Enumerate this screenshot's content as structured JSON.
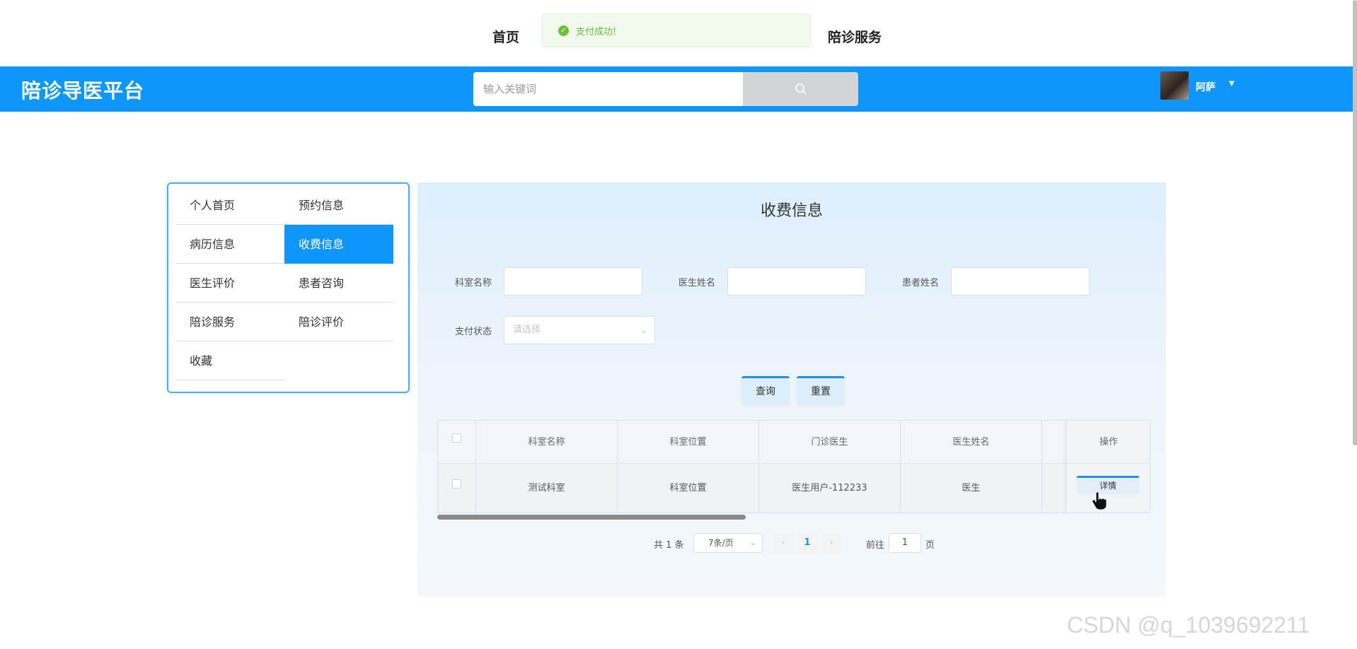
{
  "nav": {
    "home": "首页",
    "escort_service": "陪诊服务"
  },
  "toast": {
    "message": "支付成功!",
    "icon": "check-circle-icon",
    "color": "#67c23a"
  },
  "header": {
    "logo": "陪诊导医平台",
    "search_placeholder": "输入关键词",
    "username": "阿萨",
    "brand_color": "#0e96fa"
  },
  "sidebar": {
    "items": [
      {
        "label": "个人首页",
        "active": false
      },
      {
        "label": "预约信息",
        "active": false
      },
      {
        "label": "病历信息",
        "active": false
      },
      {
        "label": "收费信息",
        "active": true
      },
      {
        "label": "医生评价",
        "active": false
      },
      {
        "label": "患者咨询",
        "active": false
      },
      {
        "label": "陪诊服务",
        "active": false
      },
      {
        "label": "陪诊评价",
        "active": false
      },
      {
        "label": "收藏",
        "active": false
      }
    ]
  },
  "main": {
    "title": "收费信息",
    "filters": {
      "dept_name_label": "科室名称",
      "doctor_name_label": "医生姓名",
      "patient_name_label": "患者姓名",
      "pay_status_label": "支付状态",
      "pay_status_placeholder": "请选择",
      "query_button": "查询",
      "reset_button": "重置"
    },
    "table": {
      "columns": [
        "科室名称",
        "科室位置",
        "门诊医生",
        "医生姓名",
        "操作"
      ],
      "rows": [
        {
          "dept_name": "测试科室",
          "dept_location": "科室位置",
          "clinic_doctor": "医生用户-112233",
          "doctor_name": "医生",
          "action": "详情"
        }
      ]
    },
    "pagination": {
      "total": "共 1 条",
      "page_size": "7条/页",
      "current_page": "1",
      "goto_prefix": "前往",
      "goto_value": "1",
      "goto_suffix": "页"
    }
  },
  "watermark": "CSDN @q_1039692211"
}
